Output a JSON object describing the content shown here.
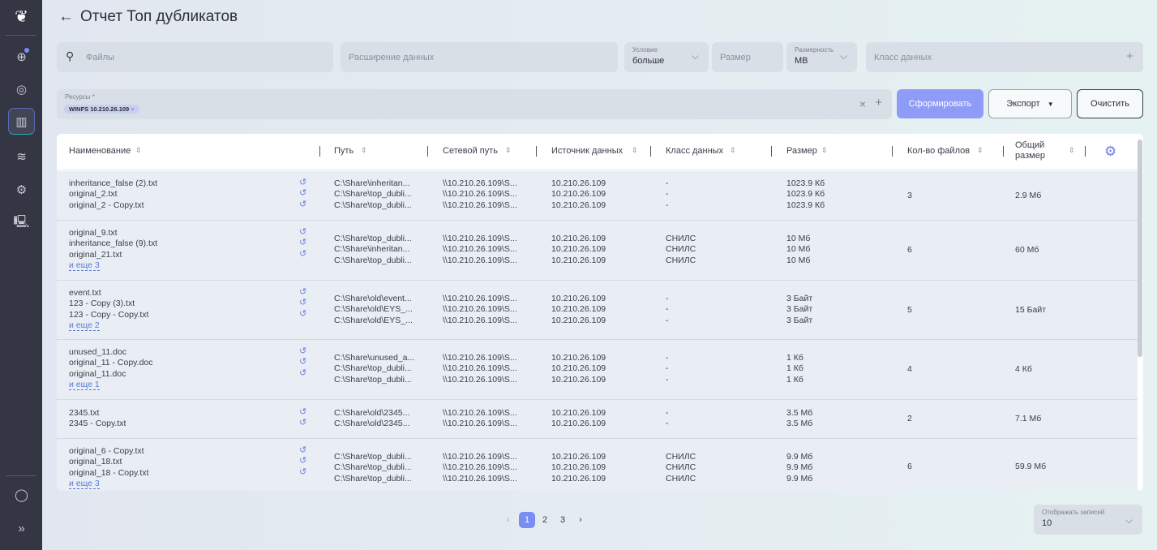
{
  "page": {
    "title": "Отчет Топ дубликатов",
    "back_icon": "arrow-left-icon"
  },
  "sidebar": {
    "items": [
      {
        "icon": "globe-icon"
      },
      {
        "icon": "eye-icon"
      },
      {
        "icon": "chart-icon",
        "active": true
      },
      {
        "icon": "layers-icon"
      },
      {
        "icon": "gear-icon"
      },
      {
        "icon": "network-folder-icon"
      },
      {
        "icon": "user-icon"
      },
      {
        "icon": "expand-icon"
      }
    ]
  },
  "filters": {
    "files_placeholder": "Файлы",
    "extension_placeholder": "Расширение данных",
    "condition_label": "Условие",
    "condition_value": "больше",
    "size_placeholder": "Размер",
    "unit_label": "Размерность",
    "unit_value": "MB",
    "class_placeholder": "Класс данных",
    "resources_label": "Ресурсы *",
    "resource_chip": "WINFS 10.210.26.109"
  },
  "buttons": {
    "generate": "Сформировать",
    "export": "Экспорт",
    "clear": "Очистить"
  },
  "table": {
    "headers": [
      "Наименование",
      "Путь",
      "Сетевой путь",
      "Источник данных",
      "Класс данных",
      "Размер",
      "Кол-во файлов",
      "Общий размер"
    ],
    "rows": [
      {
        "names": [
          "inheritance_false (2).txt",
          "original_2.txt",
          "original_2 - Copy.txt"
        ],
        "more": "",
        "paths": [
          "C:\\Share\\inheritan...",
          "C:\\Share\\top_dubli...",
          "C:\\Share\\top_dubli..."
        ],
        "net": [
          "\\\\10.210.26.109\\S...",
          "\\\\10.210.26.109\\S...",
          "\\\\10.210.26.109\\S..."
        ],
        "src": [
          "10.210.26.109",
          "10.210.26.109",
          "10.210.26.109"
        ],
        "cls": [
          "-",
          "-",
          "-"
        ],
        "size": [
          "1023.9 Кб",
          "1023.9 Кб",
          "1023.9 Кб"
        ],
        "count": "3",
        "total": "2.9 Мб"
      },
      {
        "names": [
          "original_9.txt",
          "inheritance_false (9).txt",
          "original_21.txt"
        ],
        "more": "и еще 3",
        "paths": [
          "C:\\Share\\top_dubli...",
          "C:\\Share\\inheritan...",
          "C:\\Share\\top_dubli..."
        ],
        "net": [
          "\\\\10.210.26.109\\S...",
          "\\\\10.210.26.109\\S...",
          "\\\\10.210.26.109\\S..."
        ],
        "src": [
          "10.210.26.109",
          "10.210.26.109",
          "10.210.26.109"
        ],
        "cls": [
          "СНИЛС",
          "СНИЛС",
          "СНИЛС"
        ],
        "size": [
          "10 Мб",
          "10 Мб",
          "10 Мб"
        ],
        "count": "6",
        "total": "60 Мб"
      },
      {
        "names": [
          "event.txt",
          "123 - Copy (3).txt",
          "123 - Copy - Copy.txt"
        ],
        "more": "и еще 2",
        "paths": [
          "C:\\Share\\old\\event...",
          "C:\\Share\\old\\EYS_...",
          "C:\\Share\\old\\EYS_..."
        ],
        "net": [
          "\\\\10.210.26.109\\S...",
          "\\\\10.210.26.109\\S...",
          "\\\\10.210.26.109\\S..."
        ],
        "src": [
          "10.210.26.109",
          "10.210.26.109",
          "10.210.26.109"
        ],
        "cls": [
          "-",
          "-",
          "-"
        ],
        "size": [
          "3 Байт",
          "3 Байт",
          "3 Байт"
        ],
        "count": "5",
        "total": "15 Байт"
      },
      {
        "names": [
          "unused_11.doc",
          "original_11 - Copy.doc",
          "original_11.doc"
        ],
        "more": "и еще 1",
        "paths": [
          "C:\\Share\\unused_a...",
          "C:\\Share\\top_dubli...",
          "C:\\Share\\top_dubli..."
        ],
        "net": [
          "\\\\10.210.26.109\\S...",
          "\\\\10.210.26.109\\S...",
          "\\\\10.210.26.109\\S..."
        ],
        "src": [
          "10.210.26.109",
          "10.210.26.109",
          "10.210.26.109"
        ],
        "cls": [
          "-",
          "-",
          "-"
        ],
        "size": [
          "1 Кб",
          "1 Кб",
          "1 Кб"
        ],
        "count": "4",
        "total": "4 Кб"
      },
      {
        "names": [
          "2345.txt",
          "2345 - Copy.txt"
        ],
        "more": "",
        "paths": [
          "C:\\Share\\old\\2345...",
          "C:\\Share\\old\\2345..."
        ],
        "net": [
          "\\\\10.210.26.109\\S...",
          "\\\\10.210.26.109\\S..."
        ],
        "src": [
          "10.210.26.109",
          "10.210.26.109"
        ],
        "cls": [
          "-",
          "-"
        ],
        "size": [
          "3.5 Мб",
          "3.5 Мб"
        ],
        "count": "2",
        "total": "7.1 Мб"
      },
      {
        "names": [
          "original_6 - Copy.txt",
          "original_18.txt",
          "original_18 - Copy.txt"
        ],
        "more": "и еще 3",
        "paths": [
          "C:\\Share\\top_dubli...",
          "C:\\Share\\top_dubli...",
          "C:\\Share\\top_dubli..."
        ],
        "net": [
          "\\\\10.210.26.109\\S...",
          "\\\\10.210.26.109\\S...",
          "\\\\10.210.26.109\\S..."
        ],
        "src": [
          "10.210.26.109",
          "10.210.26.109",
          "10.210.26.109"
        ],
        "cls": [
          "СНИЛС",
          "СНИЛС",
          "СНИЛС"
        ],
        "size": [
          "9.9 Мб",
          "9.9 Мб",
          "9.9 Мб"
        ],
        "count": "6",
        "total": "59.9 Мб"
      }
    ]
  },
  "pagination": {
    "pages": [
      "1",
      "2",
      "3"
    ],
    "current": "1",
    "page_size_label": "Отображать записей",
    "page_size": "10"
  },
  "colors": {
    "accent": "#7b8cf5",
    "sidebar": "#343644"
  }
}
